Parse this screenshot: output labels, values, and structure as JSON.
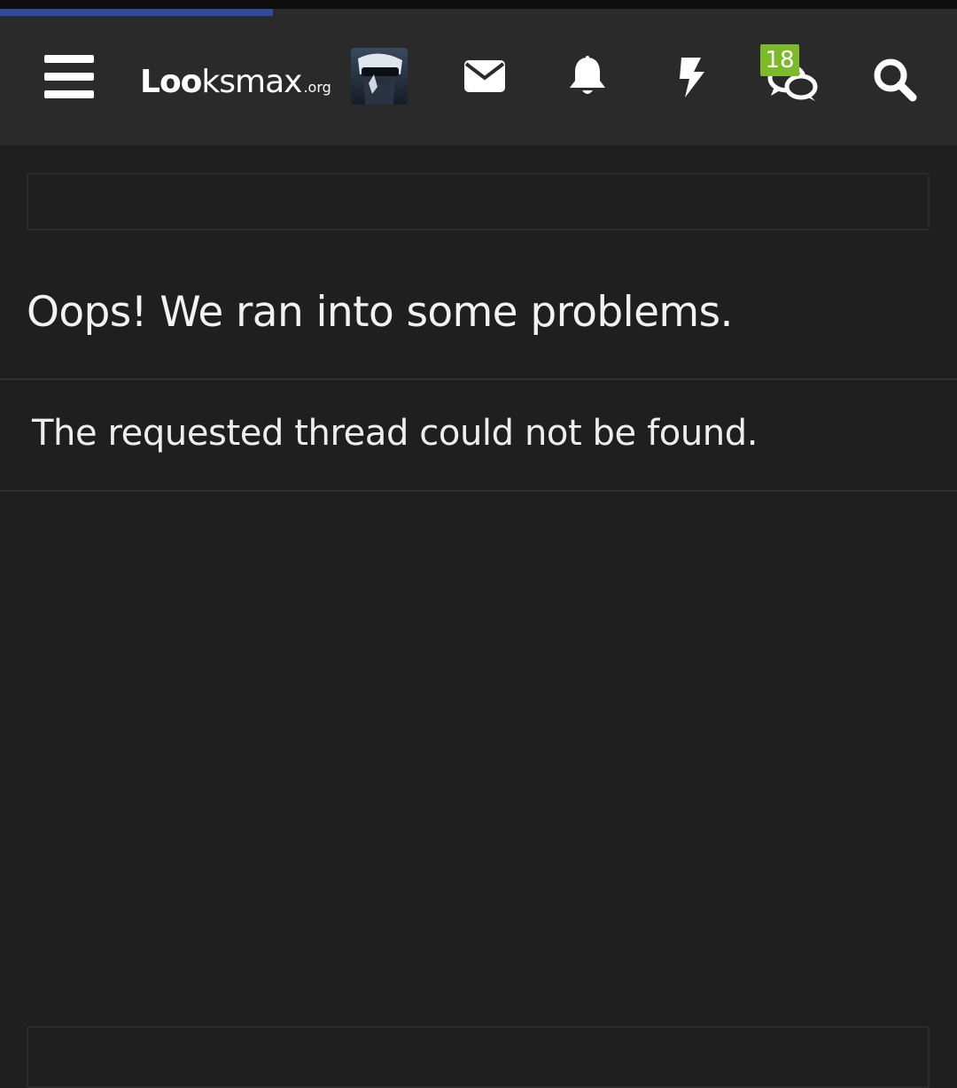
{
  "header": {
    "logo": {
      "main": "Lo",
      "oo": "o",
      "rest": "ksmax",
      "tld": ".org"
    },
    "icons": {
      "menu": "hamburger-menu-icon",
      "avatar": "user-avatar",
      "inbox": "envelope-icon",
      "alerts": "bell-icon",
      "whats_new": "bolt-icon",
      "conversations": "chat-bubbles-icon",
      "search": "search-icon"
    },
    "conversations_badge": "18"
  },
  "content": {
    "title": "Oops! We ran into some problems.",
    "message": "The requested thread could not be found."
  },
  "colors": {
    "header_bg": "#2a2a2a",
    "page_bg": "#1f1f1f",
    "badge_bg": "#7cba2a",
    "progress": "#2f4a9a"
  }
}
